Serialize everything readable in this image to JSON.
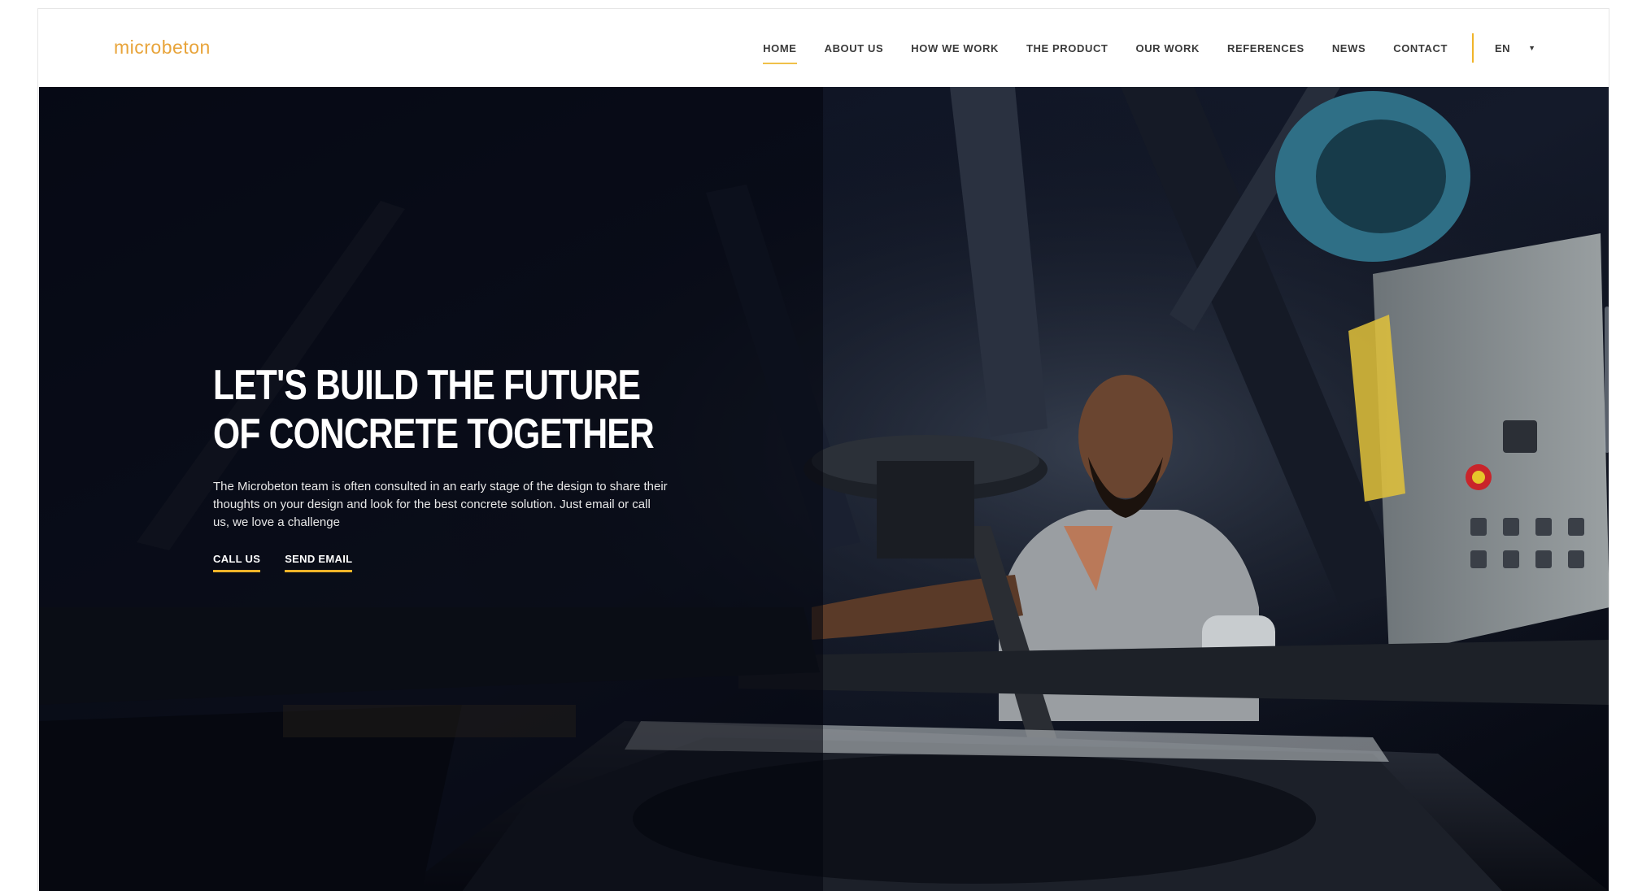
{
  "header": {
    "logo_text": "microbeton",
    "nav": [
      {
        "label": "HOME",
        "active": true
      },
      {
        "label": "ABOUT US",
        "active": false
      },
      {
        "label": "HOW WE WORK",
        "active": false
      },
      {
        "label": "THE PRODUCT",
        "active": false
      },
      {
        "label": "OUR WORK",
        "active": false
      },
      {
        "label": "REFERENCES",
        "active": false
      },
      {
        "label": "NEWS",
        "active": false
      },
      {
        "label": "CONTACT",
        "active": false
      }
    ],
    "language": {
      "selected": "EN",
      "icon": "chevron-down-icon"
    }
  },
  "hero": {
    "title_line1": "LET'S BUILD THE FUTURE",
    "title_line2": "OF CONCRETE TOGETHER",
    "text": "The Microbeton team is often consulted in an early stage of the design to share their thoughts on your design and look for the best concrete solution. Just email or call us, we love a challenge",
    "call_label": "CALL US",
    "email_label": "SEND EMAIL"
  },
  "colors": {
    "accent": "#f0b429",
    "logo": "#e8a43a",
    "hero_dark": "#070b17",
    "nav_text": "#3a3a3a"
  }
}
